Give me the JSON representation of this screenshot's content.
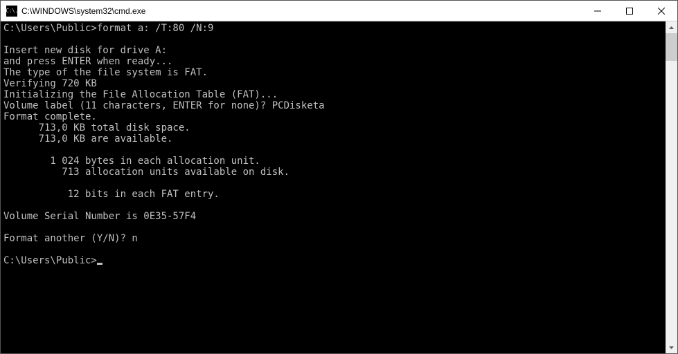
{
  "titlebar": {
    "icon_text": "C:\\.",
    "title": "C:\\WINDOWS\\system32\\cmd.exe"
  },
  "console": {
    "prompt1": "C:\\Users\\Public>",
    "command1": "format a: /T:80 /N:9",
    "lines": [
      "",
      "Insert new disk for drive A:",
      "and press ENTER when ready...",
      "The type of the file system is FAT.",
      "Verifying 720 KB",
      "Initializing the File Allocation Table (FAT)...",
      "Volume label (11 characters, ENTER for none)? PCDisketa",
      "Format complete.",
      "      713,0 KB total disk space.",
      "      713,0 KB are available.",
      "",
      "        1 024 bytes in each allocation unit.",
      "          713 allocation units available on disk.",
      "",
      "           12 bits in each FAT entry.",
      "",
      "Volume Serial Number is 0E35-57F4",
      "",
      "Format another (Y/N)? n",
      ""
    ],
    "prompt2": "C:\\Users\\Public>"
  }
}
